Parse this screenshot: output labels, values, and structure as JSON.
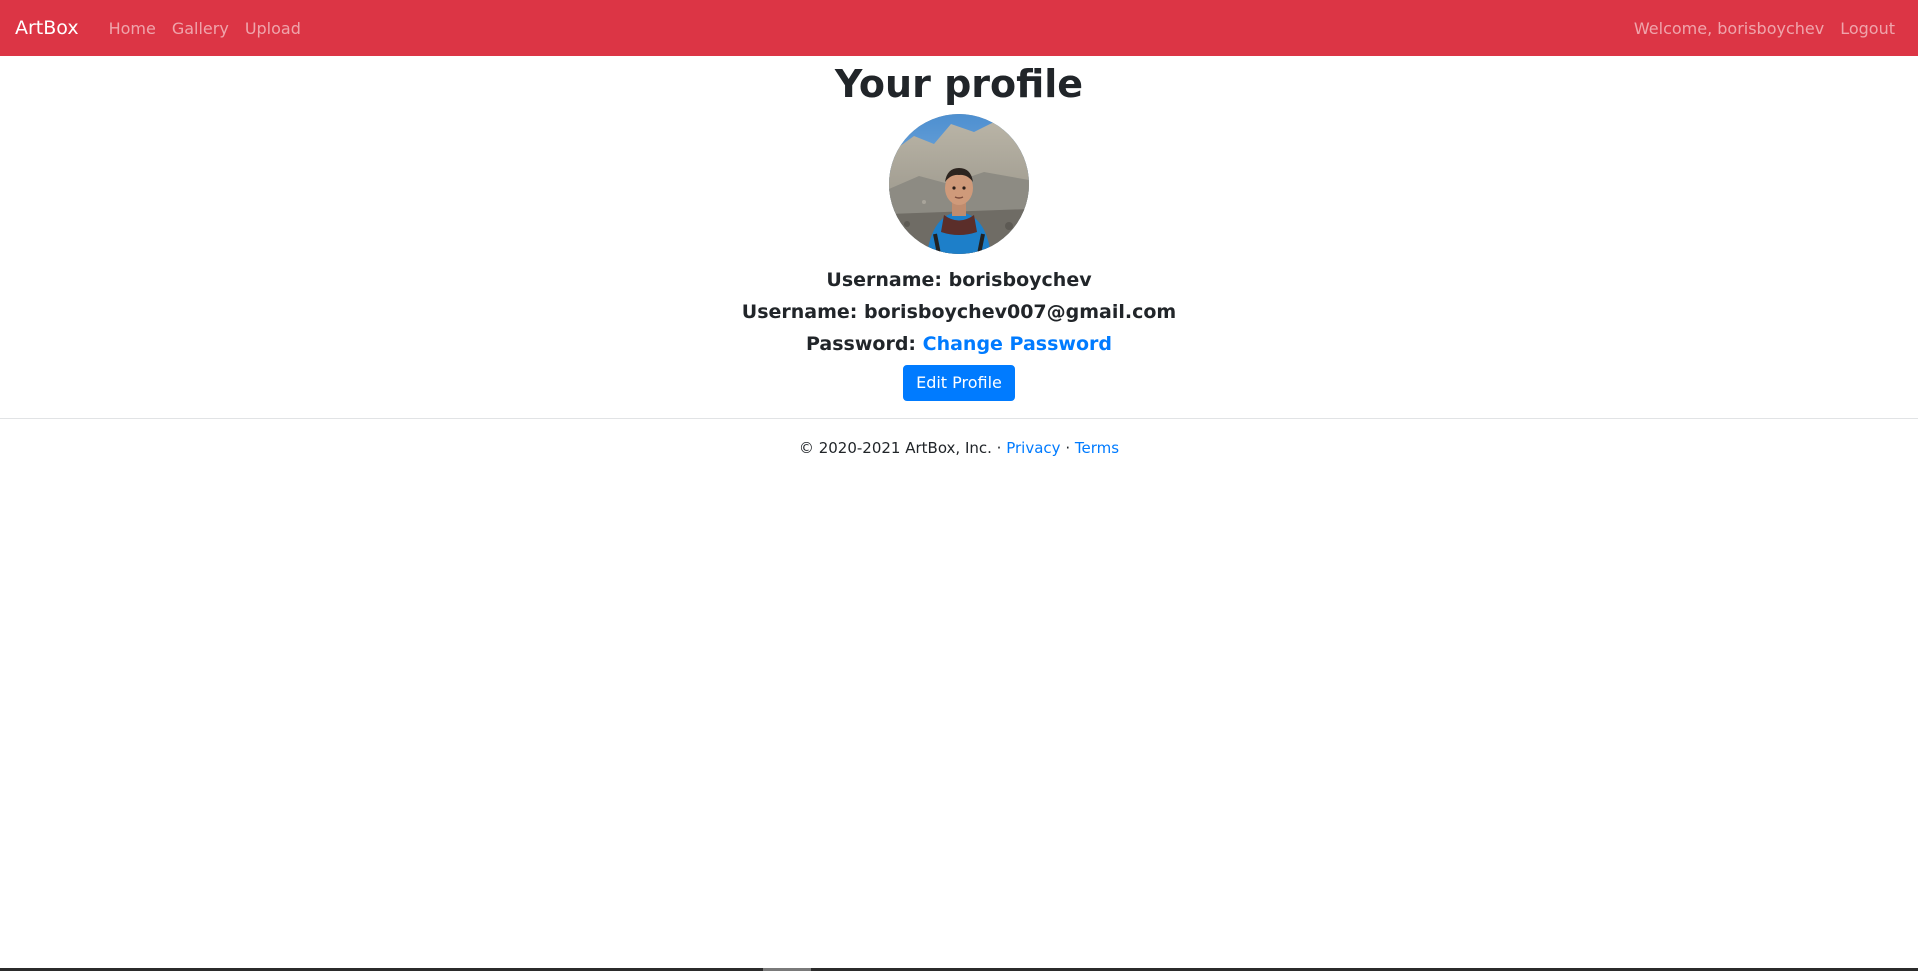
{
  "navbar": {
    "brand": "ArtBox",
    "links": [
      "Home",
      "Gallery",
      "Upload"
    ],
    "welcome": "Welcome, borisboychev",
    "logout": "Logout",
    "color": "#dc3545"
  },
  "profile": {
    "title": "Your profile",
    "avatar_icon": "user-photo",
    "username_label": "Username:",
    "username_value": "borisboychev",
    "email_label": "Username:",
    "email_value": "borisboychev007@gmail.com",
    "password_label": "Password:",
    "password_link": "Change Password",
    "edit_button": "Edit Profile"
  },
  "footer": {
    "copyright": "© 2020-2021 ArtBox, Inc. ·",
    "privacy": "Privacy",
    "separator": "·",
    "terms": "Terms"
  },
  "colors": {
    "accent": "#007bff",
    "navbar": "#dc3545"
  }
}
